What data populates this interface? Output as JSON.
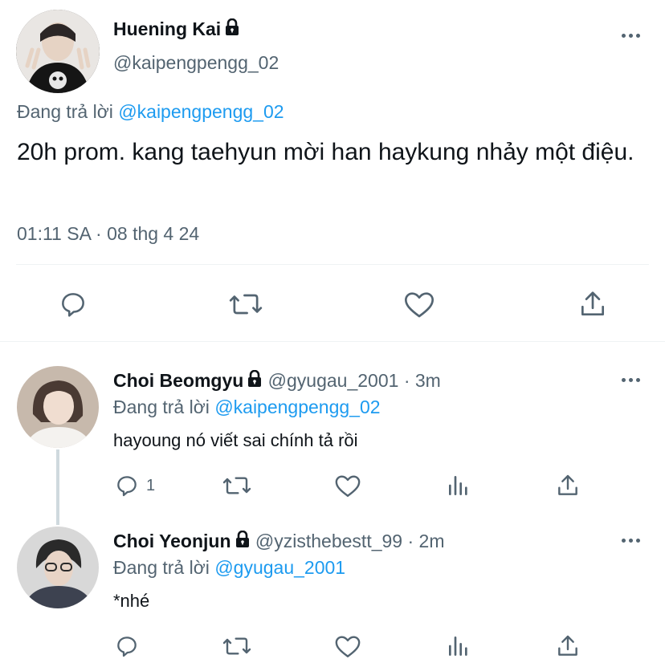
{
  "main_tweet": {
    "name": "Huening Kai",
    "handle": "@kaipengpengg_02",
    "reply_prefix": "Đang trả lời",
    "reply_to": "@kaipengpengg_02",
    "text": "20h prom. kang taehyun mời han haykung nhảy một điệu.",
    "timestamp": "01:11 SA · 08 thg 4 24"
  },
  "replies": [
    {
      "name": "Choi Beomgyu",
      "handle": "@gyugau_2001",
      "time": "· 3m",
      "reply_prefix": "Đang trả lời",
      "reply_to": "@kaipengpengg_02",
      "text": "hayoung nó viết sai chính tả rồi",
      "reply_count": "1"
    },
    {
      "name": "Choi Yeonjun",
      "handle": "@yzisthebestt_99",
      "time": "· 2m",
      "reply_prefix": "Đang trả lời",
      "reply_to": "@gyugau_2001",
      "text": "*nhé",
      "reply_count": ""
    }
  ],
  "colors": {
    "accent": "#1d9bf0",
    "icon_gray": "#536471",
    "divider": "#eff3f4"
  },
  "icons": [
    "reply-icon",
    "retweet-icon",
    "like-icon",
    "share-icon",
    "views-icon",
    "lock-icon",
    "more-icon"
  ]
}
